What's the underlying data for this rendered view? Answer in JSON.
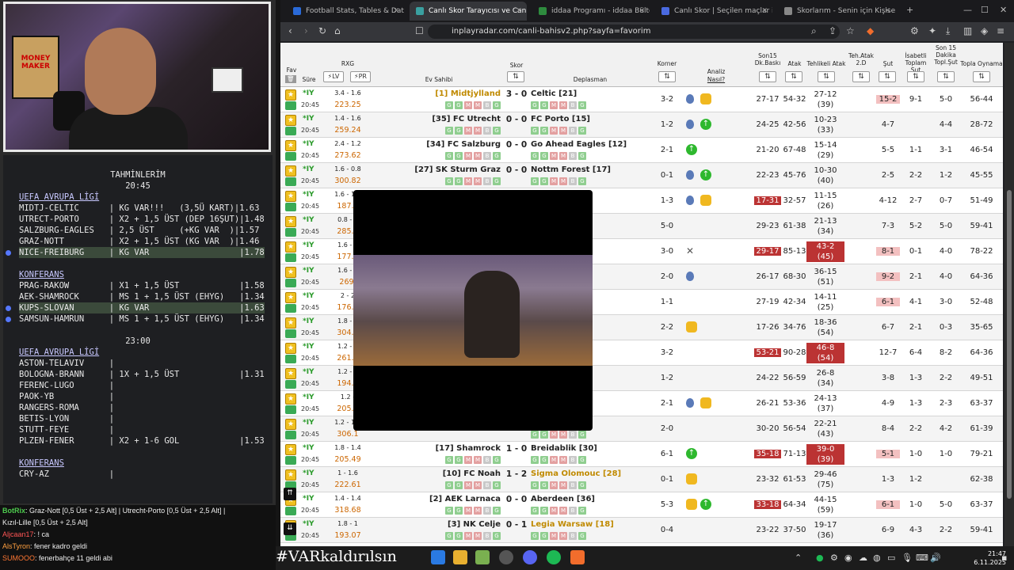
{
  "chat": [
    {
      "user": "BotRix",
      "text": ": Graz-Nott [0,5 Üst + 2,5 Alt] | Utrecht-Porto [0,5 Üst + 2,5 Alt] |"
    },
    {
      "user": "",
      "text": "Kızıl-Lille [0,5 Üst + 2,5 Alt]"
    },
    {
      "user": "Aljcaan17",
      "text": ": ! ca"
    },
    {
      "user": "AlsTyron",
      "text": ": fener kadro geldi"
    },
    {
      "user": "SUMOOO",
      "text": ": fenerbahçe 11 geldi abi"
    }
  ],
  "predictions": {
    "title": "TAHMİNLERİM",
    "lines": [
      {
        "t": "TAHMİNLERİM",
        "center": true
      },
      {
        "t": "20:45",
        "center": true
      },
      {
        "t": "UEFA AVRUPA LİGİ",
        "header": true
      },
      {
        "t": "MIDTJ-CELTIC      | KG VAR!!!   (3,5Ü KART)|1.63"
      },
      {
        "t": "UTRECT-PORTO      | X2 + 1,5 ÜST (DEP 16ŞUT)|1.48"
      },
      {
        "t": "SALZBURG-EAGLES   | 2,5 ÜST     (+KG VAR  )|1.57"
      },
      {
        "t": "GRAZ-NOTT         | X2 + 1,5 ÜST (KG VAR  )|1.46"
      },
      {
        "t": "NICE-FREIBURG     | KG VAR                  |1.78",
        "hl": true
      },
      {
        "t": ""
      },
      {
        "t": "KONFERANS",
        "header": true
      },
      {
        "t": "PRAG-RAKOW        | X1 + 1,5 ÜST            |1.58"
      },
      {
        "t": "AEK-SHAMROCK      | MS 1 + 1,5 ÜST (EHYG)   |1.34"
      },
      {
        "t": "KUPS-SLOVAN       | KG VAR                  |1.63",
        "hl": true
      },
      {
        "t": "SAMSUN-HAMRUN     | MS 1 + 1,5 ÜST (EHYG)   |1.34"
      },
      {
        "t": ""
      },
      {
        "t": "23:00",
        "center": true
      },
      {
        "t": "UEFA AVRUPA LİGİ",
        "header": true
      },
      {
        "t": "ASTON-TELAVIV     |"
      },
      {
        "t": "BOLOGNA-BRANN     | 1X + 1,5 ÜST            |1.31"
      },
      {
        "t": "FERENC-LUGO       |"
      },
      {
        "t": "PAOK-YB           |"
      },
      {
        "t": "RANGERS-ROMA      |"
      },
      {
        "t": "BETIS-LYON        |"
      },
      {
        "t": "STUTT-FEYE        |"
      },
      {
        "t": "PLZEN-FENER       | X2 + 1-6 GOL            |1.53"
      },
      {
        "t": ""
      },
      {
        "t": "KONFERANS",
        "header": true
      },
      {
        "t": "CRY-AZ            |"
      }
    ]
  },
  "browser": {
    "tabs": [
      {
        "label": "Football Stats, Tables & Data | Soc",
        "color": "#2a6ad8"
      },
      {
        "label": "Canlı Skor Tarayıcısı ve Canlı S",
        "color": "#3aa0a0",
        "active": true
      },
      {
        "label": "iddaa Programı - iddaa Bülteni | id",
        "color": "#2e8b3e"
      },
      {
        "label": "Canlı Skor | Seçilen maçlar için can",
        "color": "#4a6ae0"
      },
      {
        "label": "Skorlarım - Senin için Kişiselleştiril",
        "color": "#888"
      }
    ],
    "url": "inplayradar.com/canli-bahisv2.php?sayfa=favorim"
  },
  "table": {
    "headers": {
      "fav": "Fav",
      "sure": "Süre",
      "rxg": "RXG",
      "lv": "LV",
      "pr": "PR",
      "home": "Ev Sahibi",
      "skor": "Skor",
      "away": "Deplasman",
      "korner": "Korner",
      "analiz": "Analiz",
      "nasil": "Nasıl?",
      "son15": "Son15 Dk.Baskı",
      "atak": "Atak",
      "tehlikeli": "Tehlikeli Atak",
      "tehatak": "Teh.Atak 2.D",
      "sut": "Şut",
      "isabetli": "İsabetli Toplam Şut",
      "son15d": "Son 15 Dakika Topl.Şut",
      "topla": "Topla Oynama"
    },
    "rows": [
      {
        "iy": "*IY",
        "time": "20:45",
        "rxg": "3.4 - 1.6",
        "rxgv": "223.25",
        "home": "[1] Midtjylland",
        "homehl": true,
        "score": "3 - 0",
        "away": "Celtic [21]",
        "corner": "3-2",
        "baski": "27-17",
        "atak": "54-32",
        "teh": "27-12",
        "teh2": "(39)",
        "sut": "15-2",
        "sutc": "pink",
        "isab": "9-1",
        "s15": "5-0",
        "topla": "56-44",
        "icons": [
          "ball",
          "bag"
        ]
      },
      {
        "iy": "*IY",
        "time": "20:45",
        "rxg": "1.4 - 1.6",
        "rxgv": "259.24",
        "home": "[35] FC Utrecht",
        "score": "0 - 0",
        "away": "FC Porto [15]",
        "corner": "1-2",
        "baski": "24-25",
        "atak": "42-56",
        "teh": "10-23",
        "teh2": "(33)",
        "sut": "4-7",
        "isab": "",
        "s15": "4-4",
        "topla": "28-72",
        "icons": [
          "ball",
          "green"
        ]
      },
      {
        "iy": "*IY",
        "time": "20:45",
        "rxg": "2.4 - 1.2",
        "rxgv": "273.62",
        "home": "[34] FC Salzburg",
        "score": "0 - 0",
        "away": "Go Ahead Eagles [12]",
        "corner": "2-1",
        "baski": "21-20",
        "atak": "67-48",
        "teh": "15-14",
        "teh2": "(29)",
        "sut": "5-5",
        "isab": "1-1",
        "s15": "3-1",
        "topla": "46-54",
        "icons": [
          "green"
        ]
      },
      {
        "iy": "*IY",
        "time": "20:45",
        "rxg": "1.6 - 0.8",
        "rxgv": "300.82",
        "home": "[27] SK Sturm Graz",
        "score": "0 - 0",
        "away": "Nottm Forest [17]",
        "corner": "0-1",
        "baski": "22-23",
        "atak": "45-76",
        "teh": "10-30",
        "teh2": "(40)",
        "sut": "2-5",
        "isab": "2-2",
        "s15": "1-2",
        "topla": "45-55",
        "icons": [
          "ball",
          "green"
        ]
      },
      {
        "iy": "*IY",
        "time": "20:45",
        "rxg": "1.6 - 1.4",
        "rxgv": "187.3",
        "home": "",
        "score": "",
        "away": "",
        "corner": "1-3",
        "baski": "17-31",
        "baskic": "red",
        "atak": "32-57",
        "teh": "11-15",
        "teh2": "(26)",
        "sut": "4-12",
        "isab": "2-7",
        "s15": "0-7",
        "topla": "51-49",
        "icons": [
          "ball",
          "bag"
        ]
      },
      {
        "iy": "*IY",
        "time": "20:45",
        "rxg": "0.8 - 1",
        "rxgv": "285.7",
        "home": "",
        "score": "",
        "away": "owa [8]",
        "corner": "5-0",
        "baski": "29-23",
        "atak": "61-38",
        "teh": "21-13",
        "teh2": "(34)",
        "sut": "7-3",
        "isab": "5-2",
        "s15": "5-0",
        "topla": "59-41",
        "icons": []
      },
      {
        "iy": "*IY",
        "time": "20:45",
        "rxg": "1.6 - 0",
        "rxgv": "177.0",
        "home": "",
        "score": "",
        "away": "s [33]",
        "corner": "3-0",
        "baski": "29-17",
        "baskic": "red",
        "atak": "85-13",
        "teh": "43-2",
        "teh2": "(45)",
        "tehc": "red",
        "sut": "8-1",
        "sutc": "pink",
        "isab": "0-1",
        "s15": "4-0",
        "topla": "78-22",
        "icons": [
          "x"
        ]
      },
      {
        "iy": "*IY",
        "time": "20:45",
        "rxg": "1.6 - 1",
        "rxgv": "269.",
        "home": "",
        "score": "",
        "away": "a [31]",
        "corner": "2-0",
        "baski": "26-17",
        "atak": "68-30",
        "teh": "36-15",
        "teh2": "(51)",
        "sut": "9-2",
        "sutc": "pink",
        "isab": "2-1",
        "s15": "4-0",
        "topla": "64-36",
        "icons": [
          "ball"
        ]
      },
      {
        "iy": "*IY",
        "time": "20:45",
        "rxg": "2 - 2",
        "rxgv": "176.2",
        "home": "",
        "score": "",
        "away": "s [32]",
        "corner": "1-1",
        "baski": "27-19",
        "atak": "42-34",
        "teh": "14-11",
        "teh2": "(25)",
        "sut": "6-1",
        "sutc": "pink",
        "isab": "4-1",
        "s15": "3-0",
        "topla": "52-48",
        "icons": []
      },
      {
        "iy": "*IY",
        "time": "20:45",
        "rxg": "1.8 - 2",
        "rxgv": "304.0",
        "home": "",
        "score": "",
        "away": "",
        "corner": "2-2",
        "baski": "17-26",
        "atak": "34-76",
        "teh": "18-36",
        "teh2": "(54)",
        "sut": "6-7",
        "isab": "2-1",
        "s15": "0-3",
        "topla": "35-65",
        "icons": [
          "bag"
        ]
      },
      {
        "iy": "*IY",
        "time": "20:45",
        "rxg": "1.2 - 2",
        "rxgv": "261.8",
        "home": "",
        "score": "",
        "away": "",
        "corner": "3-2",
        "baski": "53-21",
        "baskic": "red",
        "atak": "90-28",
        "teh": "46-8",
        "teh2": "(54)",
        "tehc": "red",
        "sut": "12-7",
        "isab": "6-4",
        "s15": "8-2",
        "topla": "64-36",
        "icons": []
      },
      {
        "iy": "*IY",
        "time": "20:45",
        "rxg": "1.2 - 1",
        "rxgv": "194.4",
        "home": "",
        "score": "",
        "away": "",
        "corner": "1-2",
        "baski": "24-22",
        "atak": "56-59",
        "teh": "26-8",
        "teh2": "(34)",
        "sut": "3-8",
        "isab": "1-3",
        "s15": "2-2",
        "topla": "49-51",
        "icons": []
      },
      {
        "iy": "*IY",
        "time": "20:45",
        "rxg": "1.2 -",
        "rxgv": "205.0",
        "home": "",
        "score": "",
        "away": "",
        "corner": "2-1",
        "baski": "26-21",
        "atak": "53-36",
        "teh": "24-13",
        "teh2": "(37)",
        "sut": "4-9",
        "isab": "1-3",
        "s15": "2-3",
        "topla": "63-37",
        "icons": [
          "ball",
          "bag"
        ]
      },
      {
        "iy": "*IY",
        "time": "20:45",
        "rxg": "1.2 - 1.2",
        "rxgv": "306.1",
        "home": "",
        "score": "",
        "away": "[22] AS",
        "corner": "2-0",
        "baski": "30-20",
        "atak": "56-54",
        "teh": "22-21",
        "teh2": "(43)",
        "sut": "8-4",
        "isab": "2-2",
        "s15": "4-2",
        "topla": "61-39",
        "icons": []
      },
      {
        "iy": "*IY",
        "time": "20:45",
        "rxg": "1.8 - 1.4",
        "rxgv": "205.49",
        "home": "[17] Shamrock",
        "score": "1 - 0",
        "away": "Breidablik [30]",
        "corner": "6-1",
        "baski": "35-18",
        "baskic": "red",
        "atak": "71-13",
        "teh": "39-0",
        "teh2": "(39)",
        "tehc": "red",
        "sut": "5-1",
        "sutc": "pink",
        "isab": "1-0",
        "s15": "1-0",
        "topla": "79-21",
        "icons": [
          "green"
        ]
      },
      {
        "iy": "*IY",
        "time": "20:45",
        "rxg": "1 - 1.6",
        "rxgv": "222.61",
        "home": "[10] FC Noah",
        "score": "1 - 2",
        "away": "Sigma Olomouc [28]",
        "awayhl": true,
        "corner": "0-1",
        "baski": "23-32",
        "atak": "61-53",
        "teh": "29-46",
        "teh2": "(75)",
        "sut": "1-3",
        "isab": "1-2",
        "s15": "",
        "topla": "62-38",
        "icons": [
          "bag"
        ]
      },
      {
        "iy": "*IY",
        "time": "20:45",
        "rxg": "1.4 - 1.4",
        "rxgv": "318.68",
        "home": "[2] AEK Larnaca",
        "score": "0 - 0",
        "away": "Aberdeen [36]",
        "corner": "5-3",
        "baski": "33-18",
        "baskic": "red",
        "atak": "64-34",
        "teh": "44-15",
        "teh2": "(59)",
        "sut": "6-1",
        "sutc": "pink",
        "isab": "1-0",
        "s15": "5-0",
        "topla": "63-37",
        "icons": [
          "bag",
          "green"
        ]
      },
      {
        "iy": "*IY",
        "time": "20:45",
        "rxg": "1.8 - 1",
        "rxgv": "193.07",
        "home": "[3] NK Celje",
        "score": "0 - 1",
        "away": "Legia Warsaw [18]",
        "awayhl": true,
        "corner": "0-4",
        "baski": "23-22",
        "atak": "37-50",
        "teh": "19-17",
        "teh2": "(36)",
        "sut": "6-9",
        "isab": "4-3",
        "s15": "2-2",
        "topla": "59-41",
        "icons": []
      }
    ]
  },
  "overlay": {
    "caption": "2rakmn"
  },
  "taskbar": {
    "hashtag": "#VARkaldırılsın",
    "time": "21:47",
    "date": "6.11.2025"
  },
  "colors": {
    "green": "#2a9a2a",
    "red": "#b33333",
    "accent": "#c08a00"
  }
}
